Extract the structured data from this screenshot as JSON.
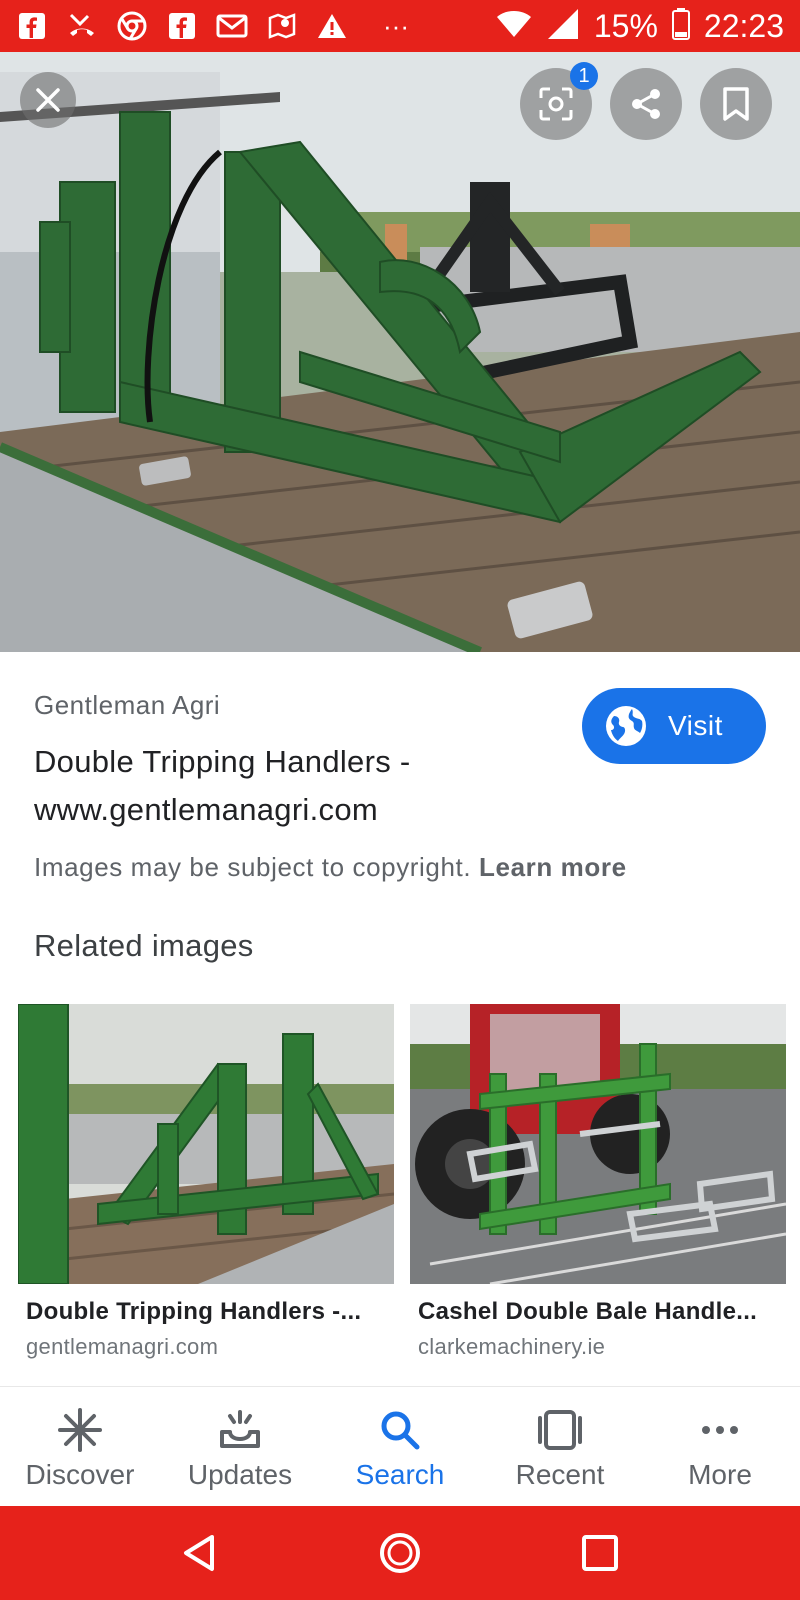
{
  "status_bar": {
    "battery": "15%",
    "time": "22:23",
    "overflow": "···"
  },
  "hero": {
    "lens_badge": "1"
  },
  "result": {
    "source": "Gentleman Agri",
    "title_line1": "Double Tripping Handlers -",
    "title_line2": "www.gentlemanagri.com",
    "visit_label": "Visit",
    "copyright_text": "Images may be subject to copyright.",
    "learn_more": "Learn more"
  },
  "related": {
    "heading": "Related images",
    "items": [
      {
        "title": "Double Tripping Handlers -...",
        "domain": "gentlemanagri.com"
      },
      {
        "title": "Cashel Double Bale Handle...",
        "domain": "clarkemachinery.ie"
      }
    ]
  },
  "bottom_nav": {
    "items": [
      {
        "label": "Discover",
        "icon": "asterisk-icon"
      },
      {
        "label": "Updates",
        "icon": "updates-tray-icon"
      },
      {
        "label": "Search",
        "icon": "search-icon"
      },
      {
        "label": "Recent",
        "icon": "recent-tabs-icon"
      },
      {
        "label": "More",
        "icon": "more-dots-icon"
      }
    ],
    "active": "Search"
  },
  "colors": {
    "system_bar": "#e6221b",
    "accent": "#1a73e8",
    "machine_green": "#2e6b35"
  }
}
